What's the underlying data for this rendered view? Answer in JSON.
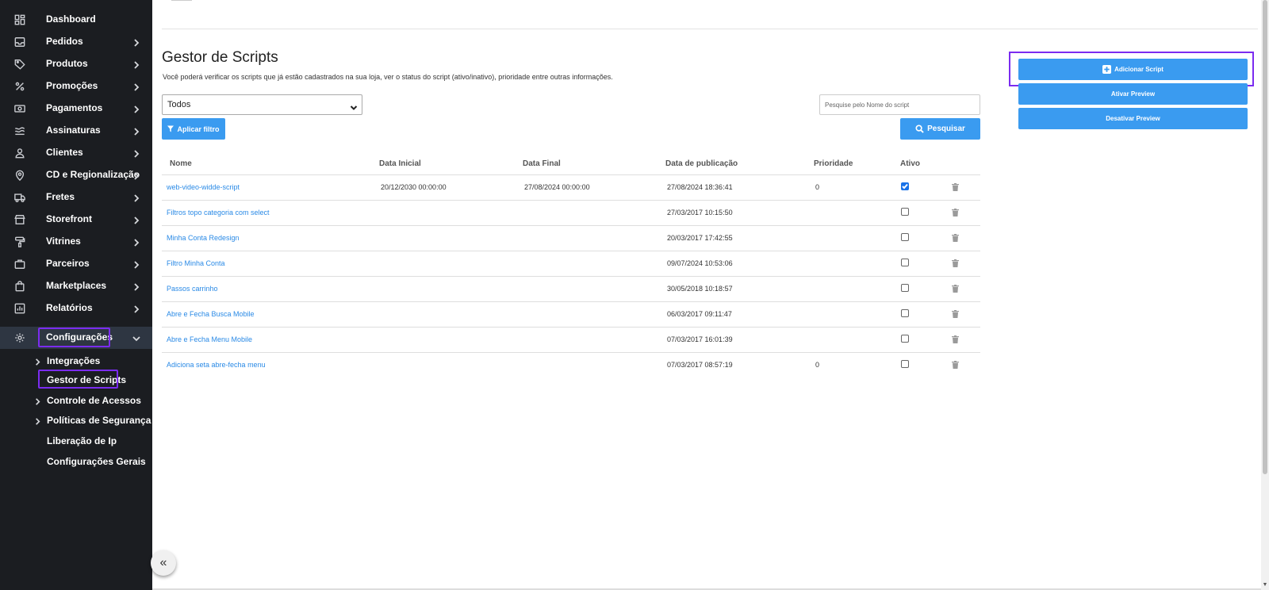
{
  "sidebar": {
    "items": [
      {
        "label": "Dashboard",
        "icon": "dashboard-icon"
      },
      {
        "label": "Pedidos",
        "icon": "inbox-icon"
      },
      {
        "label": "Produtos",
        "icon": "tag-icon"
      },
      {
        "label": "Promoções",
        "icon": "percent-icon"
      },
      {
        "label": "Pagamentos",
        "icon": "money-icon"
      },
      {
        "label": "Assinaturas",
        "icon": "subscription-icon"
      },
      {
        "label": "Clientes",
        "icon": "user-icon"
      },
      {
        "label": "CD e Regionalização",
        "icon": "location-icon"
      },
      {
        "label": "Fretes",
        "icon": "truck-icon"
      },
      {
        "label": "Storefront",
        "icon": "store-icon"
      },
      {
        "label": "Vitrines",
        "icon": "paint-roller-icon"
      },
      {
        "label": "Parceiros",
        "icon": "briefcase-icon"
      },
      {
        "label": "Marketplaces",
        "icon": "shopping-bag-icon"
      },
      {
        "label": "Relatórios",
        "icon": "report-icon"
      },
      {
        "label": "Configurações",
        "icon": "gear-icon"
      }
    ],
    "subitems": [
      {
        "label": "Integrações"
      },
      {
        "label": "Gestor de Scripts"
      },
      {
        "label": "Controle de Acessos"
      },
      {
        "label": "Políticas de Segurança"
      },
      {
        "label": "Liberação de Ip"
      },
      {
        "label": "Configurações Gerais"
      }
    ],
    "collapse_label": "«"
  },
  "main": {
    "title": "Gestor de Scripts",
    "description": "Você poderá verificar os scripts que já estão cadastrados na sua loja, ver o status do script (ativo/inativo), prioridade entre outras informações.",
    "filter_select_value": "Todos",
    "apply_filter_label": "Aplicar filtro",
    "search_placeholder": "Pesquise pelo Nome do script",
    "search_button_label": "Pesquisar",
    "add_script_label": "Adicionar Script",
    "activate_preview_label": "Ativar Preview",
    "deactivate_preview_label": "Desativar Preview"
  },
  "table": {
    "headers": [
      "Nome",
      "Data Inicial",
      "Data Final",
      "Data de publicação",
      "Prioridade",
      "Ativo"
    ],
    "rows": [
      {
        "name": "web-video-widde-script",
        "start": "20/12/2030 00:00:00",
        "end": "27/08/2024 00:00:00",
        "published": "27/08/2024 18:36:41",
        "priority": "0",
        "active": true
      },
      {
        "name": "Filtros topo categoria com select",
        "start": "",
        "end": "",
        "published": "27/03/2017 10:15:50",
        "priority": "",
        "active": false
      },
      {
        "name": "Minha Conta Redesign",
        "start": "",
        "end": "",
        "published": "20/03/2017 17:42:55",
        "priority": "",
        "active": false
      },
      {
        "name": "Filtro Minha Conta",
        "start": "",
        "end": "",
        "published": "09/07/2024 10:53:06",
        "priority": "",
        "active": false
      },
      {
        "name": "Passos carrinho",
        "start": "",
        "end": "",
        "published": "30/05/2018 10:18:57",
        "priority": "",
        "active": false
      },
      {
        "name": "Abre e Fecha Busca Mobile",
        "start": "",
        "end": "",
        "published": "06/03/2017 09:11:47",
        "priority": "",
        "active": false
      },
      {
        "name": "Abre e Fecha Menu Mobile",
        "start": "",
        "end": "",
        "published": "07/03/2017 16:01:39",
        "priority": "",
        "active": false
      },
      {
        "name": "Adiciona seta abre-fecha menu",
        "start": "",
        "end": "",
        "published": "07/03/2017 08:57:19",
        "priority": "0",
        "active": false
      }
    ]
  },
  "colors": {
    "sidebar_bg": "#1b1d21",
    "accent_blue": "#3a9bf0",
    "highlight_purple": "#7b2cf0",
    "active_marker": "#c000ff",
    "link_blue": "#2a8ae6"
  }
}
